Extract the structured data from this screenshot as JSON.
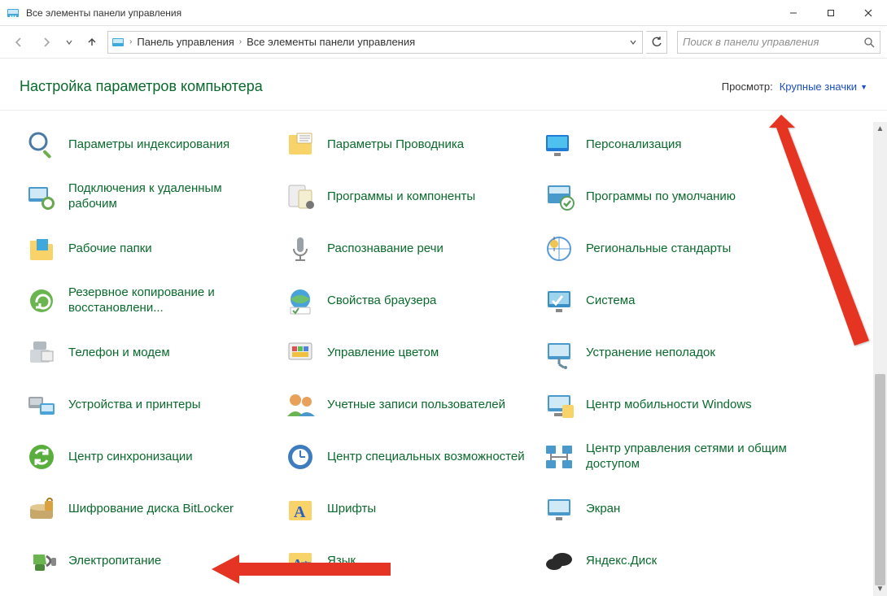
{
  "window": {
    "title": "Все элементы панели управления"
  },
  "breadcrumb": {
    "item1": "Панель управления",
    "item2": "Все элементы панели управления"
  },
  "search": {
    "placeholder": "Поиск в панели управления"
  },
  "header": {
    "title": "Настройка параметров компьютера",
    "view_label": "Просмотр:",
    "view_value": "Крупные значки"
  },
  "items": [
    {
      "label": "Параметры индексирования",
      "icon": "magnifier"
    },
    {
      "label": "Параметры Проводника",
      "icon": "folder-options"
    },
    {
      "label": "Персонализация",
      "icon": "personalize"
    },
    {
      "label": "Подключения к удаленным рабочим",
      "icon": "remote"
    },
    {
      "label": "Программы и компоненты",
      "icon": "programs"
    },
    {
      "label": "Программы по умолчанию",
      "icon": "defaults"
    },
    {
      "label": "Рабочие папки",
      "icon": "work-folders"
    },
    {
      "label": "Распознавание речи",
      "icon": "speech"
    },
    {
      "label": "Региональные стандарты",
      "icon": "region"
    },
    {
      "label": "Резервное копирование и восстановлени...",
      "icon": "backup"
    },
    {
      "label": "Свойства браузера",
      "icon": "internet-options"
    },
    {
      "label": "Система",
      "icon": "system"
    },
    {
      "label": "Телефон и модем",
      "icon": "phone"
    },
    {
      "label": "Управление цветом",
      "icon": "color"
    },
    {
      "label": "Устранение неполадок",
      "icon": "troubleshoot"
    },
    {
      "label": "Устройства и принтеры",
      "icon": "devices"
    },
    {
      "label": "Учетные записи пользователей",
      "icon": "users"
    },
    {
      "label": "Центр мобильности Windows",
      "icon": "mobility"
    },
    {
      "label": "Центр синхронизации",
      "icon": "sync"
    },
    {
      "label": "Центр специальных возможностей",
      "icon": "ease"
    },
    {
      "label": "Центр управления сетями и общим доступом",
      "icon": "network"
    },
    {
      "label": "Шифрование диска BitLocker",
      "icon": "bitlocker"
    },
    {
      "label": "Шрифты",
      "icon": "fonts"
    },
    {
      "label": "Экран",
      "icon": "display"
    },
    {
      "label": "Электропитание",
      "icon": "power"
    },
    {
      "label": "Язык",
      "icon": "language"
    },
    {
      "label": "Яндекс.Диск",
      "icon": "yadisk"
    }
  ]
}
